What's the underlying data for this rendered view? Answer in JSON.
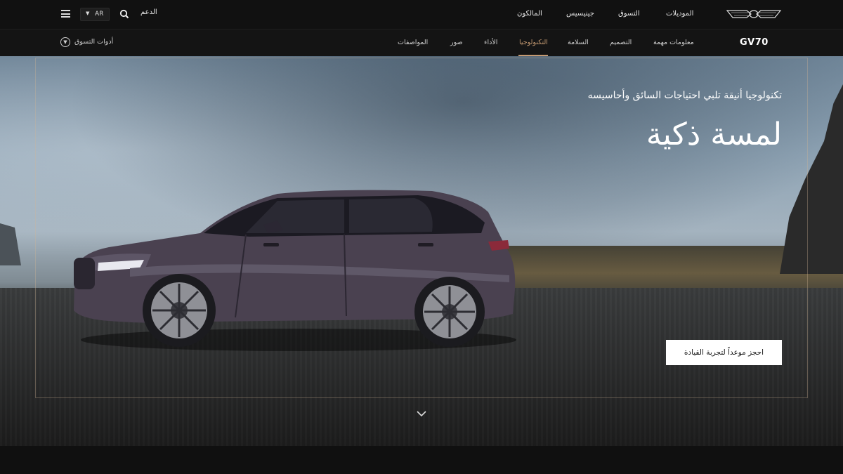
{
  "header": {
    "nav": [
      "الموديلات",
      "التسوق",
      "جينيسيس",
      "المالكون"
    ],
    "support": "الدعم",
    "language": "AR"
  },
  "subnav": {
    "model": "GV70",
    "items": [
      "معلومات مهمة",
      "التصميم",
      "السلامة",
      "التكنولوجيا",
      "الأداء",
      "صور",
      "المواصفات"
    ],
    "active_index": 3,
    "tools_label": "أدوات التسوق"
  },
  "hero": {
    "subtitle": "تكنولوجيا أنيقة تلبي احتياجات السائق وأحاسيسه",
    "title": "لمسة ذكية",
    "cta_label": "احجز موعداً لتجربة القيادة"
  },
  "colors": {
    "accent": "#c59a72",
    "header_bg": "#111111",
    "cta_bg": "#ffffff"
  },
  "icons": {
    "menu": "hamburger-icon",
    "search": "search-icon",
    "language_caret": "caret-down-icon",
    "tools": "chevron-down-circle-icon",
    "scroll": "chevron-down-icon",
    "logo": "genesis-wing-logo"
  }
}
